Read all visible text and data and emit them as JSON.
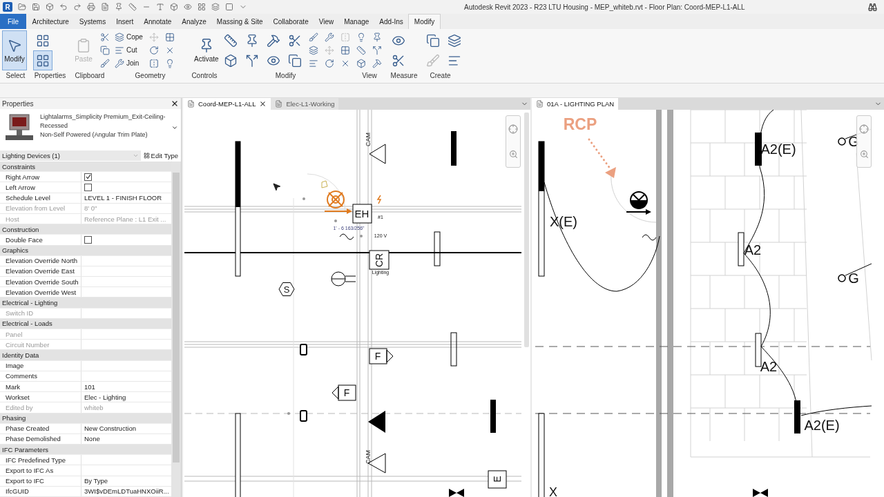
{
  "title_bar": {
    "logo": "R",
    "title": "Autodesk Revit 2023 - R23 LTU Housing - MEP_whiteb.rvt - Floor Plan: Coord-MEP-L1-ALL"
  },
  "ribbon_tabs": [
    {
      "label": "File",
      "kind": "app",
      "selected": false
    },
    {
      "label": "Architecture",
      "kind": "tab",
      "selected": false
    },
    {
      "label": "Systems",
      "kind": "tab",
      "selected": false
    },
    {
      "label": "Insert",
      "kind": "tab",
      "selected": false
    },
    {
      "label": "Annotate",
      "kind": "tab",
      "selected": false
    },
    {
      "label": "Analyze",
      "kind": "tab",
      "selected": false
    },
    {
      "label": "Massing & Site",
      "kind": "tab",
      "selected": false
    },
    {
      "label": "Collaborate",
      "kind": "tab",
      "selected": false
    },
    {
      "label": "View",
      "kind": "tab",
      "selected": false
    },
    {
      "label": "Manage",
      "kind": "tab",
      "selected": false
    },
    {
      "label": "Add-Ins",
      "kind": "tab",
      "selected": false
    },
    {
      "label": "Modify",
      "kind": "tab",
      "selected": true
    }
  ],
  "ribbon_groups": [
    {
      "label": "Select",
      "tools": [
        {
          "kind": "large",
          "label": "Modify",
          "selected": true,
          "disabled": false
        }
      ]
    },
    {
      "label": "Properties",
      "tools": [
        {
          "kind": "half",
          "selected": false,
          "disabled": false
        },
        {
          "kind": "half",
          "selected": true,
          "disabled": false
        }
      ]
    },
    {
      "label": "Clipboard",
      "tools": [
        {
          "kind": "large",
          "label": "Paste",
          "selected": false,
          "disabled": true
        },
        {
          "kind": "small",
          "selected": false,
          "disabled": false
        },
        {
          "kind": "small",
          "selected": false,
          "disabled": false
        },
        {
          "kind": "small",
          "selected": false,
          "disabled": false
        }
      ]
    },
    {
      "label": "Geometry",
      "tools": [
        {
          "kind": "small",
          "label": "Cope",
          "selected": false,
          "disabled": false
        },
        {
          "kind": "small",
          "label": "Cut",
          "selected": false,
          "disabled": false
        },
        {
          "kind": "small",
          "label": "Join",
          "selected": false,
          "disabled": false
        },
        {
          "kind": "small",
          "selected": false,
          "disabled": true
        },
        {
          "kind": "small",
          "selected": false,
          "disabled": false
        },
        {
          "kind": "small",
          "selected": false,
          "disabled": false
        },
        {
          "kind": "small",
          "selected": false,
          "disabled": false
        },
        {
          "kind": "small",
          "selected": false,
          "disabled": false
        },
        {
          "kind": "small",
          "selected": false,
          "disabled": false
        }
      ]
    },
    {
      "label": "Controls",
      "tools": [
        {
          "kind": "large",
          "label": "Activate",
          "selected": false,
          "disabled": false
        }
      ]
    },
    {
      "label": "Modify",
      "tools": [
        {
          "kind": "half",
          "selected": false,
          "disabled": false
        },
        {
          "kind": "half",
          "selected": false,
          "disabled": false
        },
        {
          "kind": "half",
          "selected": false,
          "disabled": false
        },
        {
          "kind": "half",
          "selected": false,
          "disabled": false
        },
        {
          "kind": "half",
          "selected": false,
          "disabled": false
        },
        {
          "kind": "half",
          "selected": false,
          "disabled": false
        },
        {
          "kind": "half",
          "selected": false,
          "disabled": false
        },
        {
          "kind": "half",
          "selected": false,
          "disabled": false
        },
        {
          "kind": "small",
          "selected": false,
          "disabled": false
        },
        {
          "kind": "small",
          "selected": false,
          "disabled": false
        },
        {
          "kind": "small",
          "selected": false,
          "disabled": false
        },
        {
          "kind": "small",
          "selected": false,
          "disabled": false
        },
        {
          "kind": "small",
          "selected": false,
          "disabled": true
        },
        {
          "kind": "small",
          "selected": false,
          "disabled": false
        },
        {
          "kind": "small",
          "selected": false,
          "disabled": true
        },
        {
          "kind": "small",
          "selected": false,
          "disabled": false
        },
        {
          "kind": "small",
          "selected": false,
          "disabled": false
        }
      ]
    },
    {
      "label": "View",
      "tools": [
        {
          "kind": "small",
          "selected": false,
          "disabled": false
        },
        {
          "kind": "small",
          "selected": false,
          "disabled": false
        },
        {
          "kind": "small",
          "selected": false,
          "disabled": false
        },
        {
          "kind": "small",
          "selected": false,
          "disabled": false
        },
        {
          "kind": "small",
          "selected": false,
          "disabled": false
        },
        {
          "kind": "small",
          "selected": false,
          "disabled": false
        }
      ]
    },
    {
      "label": "Measure",
      "tools": [
        {
          "kind": "half",
          "selected": false,
          "disabled": false
        },
        {
          "kind": "half",
          "selected": false,
          "disabled": false
        }
      ]
    },
    {
      "label": "Create",
      "tools": [
        {
          "kind": "half",
          "selected": false,
          "disabled": false
        },
        {
          "kind": "half",
          "selected": false,
          "disabled": true
        },
        {
          "kind": "half",
          "selected": false,
          "disabled": false
        },
        {
          "kind": "half",
          "selected": false,
          "disabled": false
        }
      ]
    }
  ],
  "properties": {
    "title": "Properties",
    "family": "Lightalarms_Simplicity Premium_Exit-Ceiling-Recessed",
    "type": "Non-Self Powered (Angular Trim Plate)",
    "filter": "Lighting Devices (1)",
    "edit_type": "Edit Type",
    "sections": [
      {
        "title": "Constraints",
        "rows": [
          {
            "label": "Right Arrow",
            "kind": "checkbox",
            "checked": true,
            "disabled": false
          },
          {
            "label": "Left Arrow",
            "kind": "checkbox",
            "checked": false,
            "disabled": false
          },
          {
            "label": "Schedule Level",
            "kind": "text",
            "value": "LEVEL 1 - FINISH FLOOR",
            "disabled": false
          },
          {
            "label": "Elevation from Level",
            "kind": "text",
            "value": "8' 0\"",
            "disabled": true
          },
          {
            "label": "Host",
            "kind": "text",
            "value": "Reference Plane : L1 Exit ...",
            "disabled": true
          }
        ]
      },
      {
        "title": "Construction",
        "rows": [
          {
            "label": "Double Face",
            "kind": "checkbox",
            "checked": false,
            "disabled": false
          }
        ]
      },
      {
        "title": "Graphics",
        "rows": [
          {
            "label": "Elevation Override North",
            "kind": "text",
            "disabled": false
          },
          {
            "label": "Elevation Override East",
            "kind": "text",
            "disabled": false
          },
          {
            "label": "Elevation Override South",
            "kind": "text",
            "disabled": false
          },
          {
            "label": "Elevation Override West",
            "kind": "text",
            "disabled": false
          }
        ]
      },
      {
        "title": "Electrical - Lighting",
        "rows": [
          {
            "label": "Switch ID",
            "kind": "text",
            "disabled": true
          }
        ]
      },
      {
        "title": "Electrical - Loads",
        "rows": [
          {
            "label": "Panel",
            "kind": "text",
            "disabled": true
          },
          {
            "label": "Circuit Number",
            "kind": "text",
            "disabled": true
          }
        ]
      },
      {
        "title": "Identity Data",
        "rows": [
          {
            "label": "Image",
            "kind": "text",
            "disabled": false
          },
          {
            "label": "Comments",
            "kind": "text",
            "disabled": false
          },
          {
            "label": "Mark",
            "kind": "text",
            "value": "101",
            "disabled": false
          },
          {
            "label": "Workset",
            "kind": "text",
            "value": "Elec - Lighting",
            "disabled": false
          },
          {
            "label": "Edited by",
            "kind": "text",
            "value": "whiteb",
            "disabled": true
          }
        ]
      },
      {
        "title": "Phasing",
        "rows": [
          {
            "label": "Phase Created",
            "kind": "text",
            "value": "New Construction",
            "disabled": false
          },
          {
            "label": "Phase Demolished",
            "kind": "text",
            "value": "None",
            "disabled": false
          }
        ]
      },
      {
        "title": "IFC Parameters",
        "rows": [
          {
            "label": "IFC Predefined Type",
            "kind": "text",
            "disabled": false
          },
          {
            "label": "Export to IFC As",
            "kind": "text",
            "disabled": false
          },
          {
            "label": "Export to IFC",
            "kind": "text",
            "value": "By Type",
            "disabled": false
          },
          {
            "label": "IfcGUID",
            "kind": "text",
            "value": "3WI$vDEmLDTuaHNXOiiR...",
            "disabled": false
          }
        ]
      }
    ]
  },
  "left_pane": {
    "tabs": [
      {
        "label": "Coord-MEP-L1-ALL",
        "selected": true
      },
      {
        "label": "Elec-L1-Working",
        "selected": false
      }
    ],
    "labels": [
      "CAM",
      "EH",
      "#1",
      "1' - 6 163/256\"",
      "120 V",
      "CR",
      "Lighting",
      "S",
      "F",
      "F",
      "CAM",
      "E"
    ]
  },
  "right_pane": {
    "tabs": [
      {
        "label": "01A - LIGHTING PLAN",
        "selected": true
      }
    ],
    "labels": [
      "RCP",
      "X(E)",
      "A2(E)",
      "A2",
      "A2",
      "A2(E)",
      "G",
      "G",
      "X"
    ]
  }
}
